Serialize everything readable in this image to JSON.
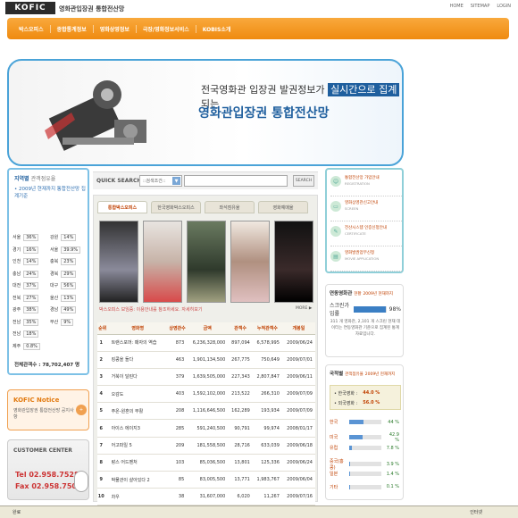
{
  "header": {
    "logo": "KOFIC",
    "site_title": "영화관입장권 통합전산망",
    "util_links": [
      "HOME",
      "SITEMAP",
      "LOGIN"
    ]
  },
  "nav": {
    "items": [
      "박스오피스",
      "종합통계정보",
      "영화상영정보",
      "극장/영화정보서비스",
      "KOBIS소개"
    ]
  },
  "banner": {
    "line1_pre": "전국영화관 입장권 발권정보가 ",
    "line1_highlight": "실시간으로 집계",
    "line1_post": " 되는",
    "line2": "영화관입장권 통합전산망"
  },
  "region": {
    "title": "지역별",
    "title_sub": "관객점유율",
    "note": "• 2009년 현재까지 통합전산망 집계기준",
    "rows": [
      [
        {
          "name": "서울",
          "value": "36%"
        },
        {
          "name": "강원",
          "value": "14%"
        }
      ],
      [
        {
          "name": "경기",
          "value": "16%"
        },
        {
          "name": "서울",
          "value": "39.9%"
        }
      ],
      [
        {
          "name": "인천",
          "value": "14%"
        },
        {
          "name": "충북",
          "value": "23%"
        }
      ],
      [
        {
          "name": "충남",
          "value": "24%"
        },
        {
          "name": "경북",
          "value": "29%"
        }
      ],
      [
        {
          "name": "대전",
          "value": "37%"
        },
        {
          "name": "대구",
          "value": "56%"
        }
      ],
      [
        {
          "name": "전북",
          "value": "27%"
        },
        {
          "name": "울산",
          "value": "13%"
        }
      ],
      [
        {
          "name": "광주",
          "value": "38%"
        },
        {
          "name": "경남",
          "value": "49%"
        }
      ],
      [
        {
          "name": "전남",
          "value": "35%"
        },
        {
          "name": "부산",
          "value": "9%"
        }
      ],
      [
        {
          "name": "전남",
          "value": "18%"
        },
        {
          "name": "",
          "value": ""
        }
      ],
      [
        {
          "name": "제주",
          "value": "0.8%"
        },
        {
          "name": "",
          "value": ""
        }
      ]
    ],
    "total_label": "전체관객수 :",
    "total_value": "78,702,407 명"
  },
  "notice": {
    "title": "KOFIC Notice",
    "text": "영화관입장권 통합전산망 공지사항",
    "more": "+"
  },
  "customer_center": {
    "title": "CUSTOMER CENTER",
    "tel": "Tel 02.958.7528",
    "fax": "Fax 02.958.7502"
  },
  "search": {
    "label": "QUICK SEARCH",
    "select_value": "::검색조건::",
    "button": "SEARCH"
  },
  "boxoffice": {
    "tabs": [
      "통합박스오피스",
      "한국영화박스오피스",
      "좌석점유율",
      "영화예매율"
    ],
    "info": "박스오피스 보임증: 이용안내를 참조하세요. 자세히보기",
    "more": "MORE ▶",
    "columns": [
      "순위",
      "영화명",
      "상영관수",
      "금액",
      "관객수",
      "누적관객수",
      "개봉일"
    ],
    "rows": [
      [
        "1",
        "트랜스포머: 패자의 역습",
        "873",
        "6,236,328,000",
        "897,094",
        "6,578,995",
        "2009/06/24"
      ],
      [
        "2",
        "킹콩을 들다",
        "463",
        "1,901,134,500",
        "267,775",
        "750,649",
        "2009/07/01"
      ],
      [
        "3",
        "거북이 달린다",
        "379",
        "1,639,505,000",
        "227,343",
        "2,807,847",
        "2009/06/11"
      ],
      [
        "4",
        "오감도",
        "403",
        "1,592,102,000",
        "213,522",
        "266,310",
        "2009/07/09"
      ],
      [
        "5",
        "주온-원혼의 부활",
        "208",
        "1,116,646,500",
        "162,289",
        "193,934",
        "2009/07/09"
      ],
      [
        "6",
        "아이스 에이지3",
        "285",
        "591,240,500",
        "90,791",
        "99,974",
        "2008/01/17"
      ],
      [
        "7",
        "어고파일 5",
        "209",
        "181,558,500",
        "28,716",
        "633,039",
        "2009/06/18"
      ],
      [
        "8",
        "랑스 어드벤처",
        "103",
        "85,036,500",
        "13,801",
        "125,336",
        "2009/06/24"
      ],
      [
        "9",
        "박물관이 살아있다 2",
        "85",
        "83,005,500",
        "13,771",
        "1,983,767",
        "2009/06/04"
      ],
      [
        "10",
        "차우",
        "38",
        "31,607,000",
        "6,020",
        "11,267",
        "2009/07/16"
      ]
    ]
  },
  "services": [
    {
      "label": "통합전산망 가입안내",
      "sub": "REGISTRATION",
      "icon": "person-icon"
    },
    {
      "label": "영화상영관신고안내",
      "sub": "SCREEN",
      "icon": "screen-icon"
    },
    {
      "label": "전산시스템 인증신청안내",
      "sub": "CERTIFICATE",
      "icon": "certificate-icon"
    },
    {
      "label": "영화발권업무신청",
      "sub": "MOVIE APPLICATION",
      "icon": "ticket-icon"
    }
  ],
  "status": {
    "title": "연동영화관",
    "title_sub": "현황",
    "date": "2009년 현재까지",
    "bar_label": "스크린가입률",
    "bar_pct": 98,
    "bar_text": "98%",
    "text": "311 개 영화관, 2,101 개 스크린 현재 데이터는 연동영화관 기준으로 집계된 통계자료입니다."
  },
  "nation": {
    "title": "국적별",
    "title_sub": "관객점유율",
    "date": "2009년 현재까지",
    "box": [
      {
        "label": "• 한국영화 :",
        "value": "44.0 %"
      },
      {
        "label": "• 외국영화 :",
        "value": "56.0 %"
      }
    ],
    "rows": [
      {
        "name": "한국",
        "pct": 44,
        "text": "44 %"
      },
      {
        "name": "미국",
        "pct": 42.9,
        "text": "42.9 %"
      },
      {
        "name": "유럽",
        "pct": 7.8,
        "text": "7.8 %"
      },
      {
        "name": "중국(홍콩)",
        "pct": 3.9,
        "text": "3.9 %"
      },
      {
        "name": "일본",
        "pct": 1.4,
        "text": "1.4 %"
      },
      {
        "name": "기타",
        "pct": 0.1,
        "text": "0.1 %"
      }
    ]
  },
  "browser_status": {
    "done": "완료",
    "zone": "인터넷"
  }
}
